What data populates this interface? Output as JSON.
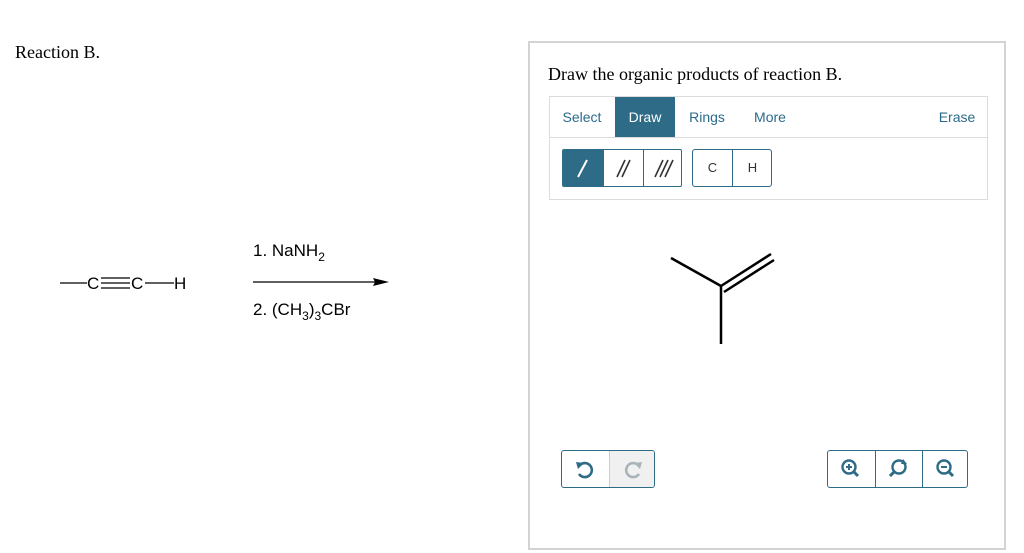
{
  "question": {
    "title": "Reaction B."
  },
  "reaction": {
    "reactant": {
      "atom1": "C",
      "atom2": "C",
      "atom3": "H"
    },
    "step1": "1. NaNH",
    "step1_sub": "2",
    "step2_a": "2. (CH",
    "step2_sub1": "3",
    "step2_b": ")",
    "step2_sub2": "3",
    "step2_c": "CBr"
  },
  "panel": {
    "prompt": "Draw the organic products of reaction B.",
    "tabs": [
      {
        "label": "Select",
        "active": false
      },
      {
        "label": "Draw",
        "active": true
      },
      {
        "label": "Rings",
        "active": false
      },
      {
        "label": "More",
        "active": false
      }
    ],
    "erase_label": "Erase",
    "bond_tools": [
      "single-bond",
      "double-bond",
      "triple-bond"
    ],
    "atom_tools": [
      "C",
      "H"
    ],
    "undo_icons": [
      "undo-icon",
      "redo-icon"
    ],
    "zoom_icons": [
      "zoom-in-icon",
      "reset-zoom-icon",
      "zoom-out-icon"
    ],
    "accent_color": "#2d6b86"
  }
}
